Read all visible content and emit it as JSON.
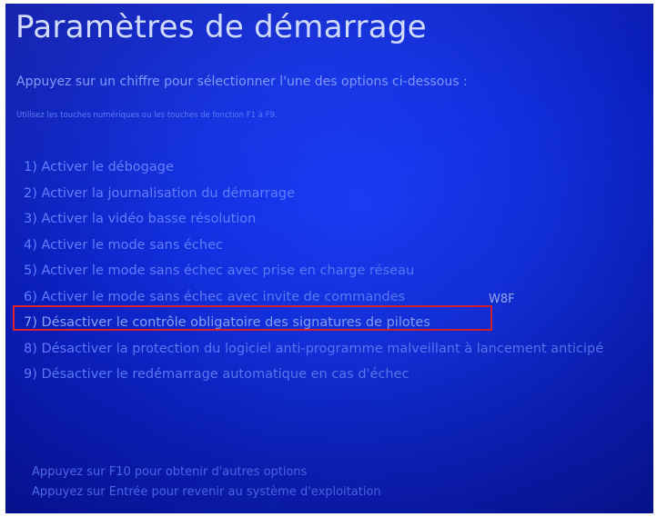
{
  "screen": {
    "title": "Paramètres de démarrage",
    "subtitle": "Appuyez sur un chiffre pour sélectionner l'une des options ci-dessous :",
    "hint": "Utilisez les touches numériques ou les touches de fonction F1 à F9."
  },
  "options": [
    {
      "label": "1) Activer le débogage"
    },
    {
      "label": "2) Activer la journalisation du démarrage"
    },
    {
      "label": "3) Activer la vidéo basse résolution"
    },
    {
      "label": "4) Activer le mode sans échec"
    },
    {
      "label": "5) Activer le mode sans échec avec prise en charge réseau"
    },
    {
      "label": "6) Activer le mode sans échec avec invite de commandes"
    },
    {
      "label": "7) Désactiver le contrôle obligatoire des signatures de pilotes"
    },
    {
      "label": "8) Désactiver la protection du logiciel anti-programme malveillant à lancement anticipé"
    },
    {
      "label": "9) Désactiver le redémarrage automatique en cas d'échec"
    }
  ],
  "annotation": {
    "watermark": "W8F",
    "highlight_color": "#e0232e",
    "highlighted_option_index": 6
  },
  "footer": {
    "more_options": "Appuyez sur F10 pour obtenir d'autres options",
    "return_to_os": "Appuyez sur Entrée pour revenir au système d'exploitation"
  },
  "colors": {
    "background": "#1230e0",
    "title": "#cfd8ff",
    "text": "#5f7dff"
  }
}
